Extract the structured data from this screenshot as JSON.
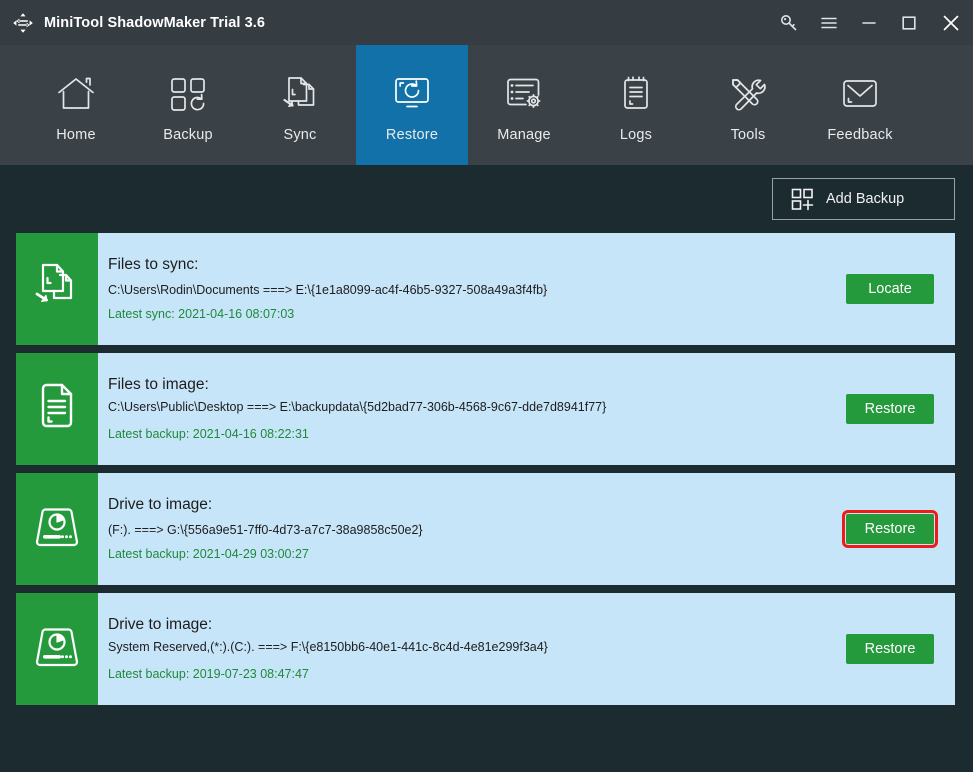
{
  "window": {
    "title": "MiniTool ShadowMaker Trial 3.6",
    "logo_icon": "four-way-arrow-logo-icon",
    "controls": [
      {
        "name": "key-icon",
        "label": "Key"
      },
      {
        "name": "menu-icon",
        "label": "Menu"
      },
      {
        "name": "minimize-icon",
        "label": "Minimize"
      },
      {
        "name": "maximize-icon",
        "label": "Maximize"
      },
      {
        "name": "close-icon",
        "label": "Close"
      }
    ]
  },
  "nav": {
    "active": "Restore",
    "items": [
      {
        "label": "Home",
        "icon": "home-icon"
      },
      {
        "label": "Backup",
        "icon": "backup-squares-refresh-icon"
      },
      {
        "label": "Sync",
        "icon": "sync-documents-arrow-icon"
      },
      {
        "label": "Restore",
        "icon": "restore-monitor-refresh-icon"
      },
      {
        "label": "Manage",
        "icon": "manage-list-gear-icon"
      },
      {
        "label": "Logs",
        "icon": "logs-clipboard-icon"
      },
      {
        "label": "Tools",
        "icon": "tools-wrench-screwdriver-icon"
      },
      {
        "label": "Feedback",
        "icon": "feedback-envelope-icon"
      }
    ]
  },
  "toolbar": {
    "add_backup_label": "Add Backup",
    "add_backup_icon": "add-backup-squares-plus-icon"
  },
  "colors": {
    "title_bar": "#353c42",
    "nav_bar": "#3b4247",
    "nav_active": "#1271a8",
    "content_bg": "#1c2b2f",
    "card_bg": "#c7e5f8",
    "card_icon_bg": "#249a3c",
    "button_green": "#249a3c",
    "meta_green": "#1f8a3b",
    "highlight_red": "#ef1b17"
  },
  "cards": [
    {
      "icon": "sync-documents-arrow-icon",
      "title": "Files to sync:",
      "path": " C:\\Users\\Rodin\\Documents ===> E:\\{1e1a8099-ac4f-46b5-9327-508a49a3f4fb}",
      "meta": "Latest sync: 2021-04-16 08:07:03",
      "action_label": "Locate",
      "highlighted": false
    },
    {
      "icon": "file-document-icon",
      "title": "Files to image:",
      "path": "C:\\Users\\Public\\Desktop ===> E:\\backupdata\\{5d2bad77-306b-4568-9c67-dde7d8941f77}",
      "meta": "Latest backup: 2021-04-16 08:22:31",
      "action_label": "Restore",
      "highlighted": false
    },
    {
      "icon": "hard-drive-icon",
      "title": "Drive to image:",
      "path": "(F:). ===> G:\\{556a9e51-7ff0-4d73-a7c7-38a9858c50e2}",
      "meta": "Latest backup: 2021-04-29 03:00:27",
      "action_label": "Restore",
      "highlighted": true
    },
    {
      "icon": "hard-drive-icon",
      "title": "Drive to image:",
      "path": " System Reserved,(*:).(C:). ===> F:\\{e8150bb6-40e1-441c-8c4d-4e81e299f3a4}",
      "meta": "Latest backup: 2019-07-23 08:47:47",
      "action_label": "Restore",
      "highlighted": false
    }
  ]
}
